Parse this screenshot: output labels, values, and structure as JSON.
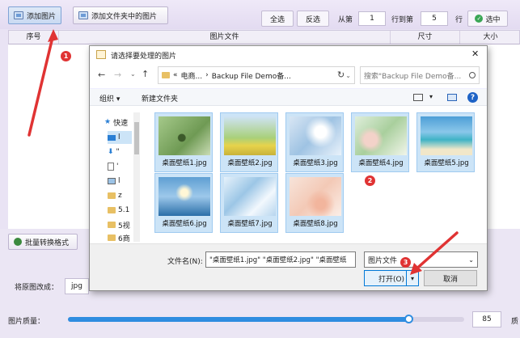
{
  "toolbar": {
    "add_image": "添加图片",
    "add_folder_images": "添加文件夹中的图片",
    "select_all": "全选",
    "invert_select": "反选",
    "from_label": "从第",
    "from_value": "1",
    "to_label": "行到第",
    "to_value": "5",
    "row_suffix": "行",
    "select_button": "选中"
  },
  "table": {
    "columns": [
      "序号",
      "图片文件",
      "尺寸",
      "大小"
    ]
  },
  "bottom": {
    "batch_convert": "批量转换格式",
    "convert_to_label": "将原图改成：",
    "format_value": "jpg",
    "quality_label": "图片质量：",
    "quality_value": "85",
    "quality_suffix": "质",
    "quality_level": 0.86
  },
  "dialog": {
    "title": "请选择要处理的图片",
    "close": "✕",
    "address_parts": [
      "«",
      "电商...",
      "›",
      "Backup File Demo备..."
    ],
    "search_placeholder": "搜索\"Backup File Demo备...",
    "organize": "组织 ▾",
    "new_folder": "新建文件夹",
    "nav_items": [
      "快速",
      "l",
      "\"",
      "'",
      "l",
      "z",
      "5.1",
      "5视",
      "6商"
    ],
    "files": [
      "桌面壁纸1.jpg",
      "桌面壁纸2.jpg",
      "桌面壁纸3.jpg",
      "桌面壁纸4.jpg",
      "桌面壁纸5.jpg",
      "桌面壁纸6.jpg",
      "桌面壁纸7.jpg",
      "桌面壁纸8.jpg"
    ],
    "filename_label": "文件名(N):",
    "filename_value": "\"桌面壁纸1.jpg\" \"桌面壁纸2.jpg\" \"桌面壁纸",
    "filetype_value": "图片文件",
    "open_button": "打开(O)",
    "cancel_button": "取消"
  },
  "annotations": [
    "1",
    "2",
    "3"
  ],
  "colors": {
    "accent": "#1e7fd8",
    "annotation_red": "#e03333",
    "selected_thumb": "#cce4f7"
  }
}
